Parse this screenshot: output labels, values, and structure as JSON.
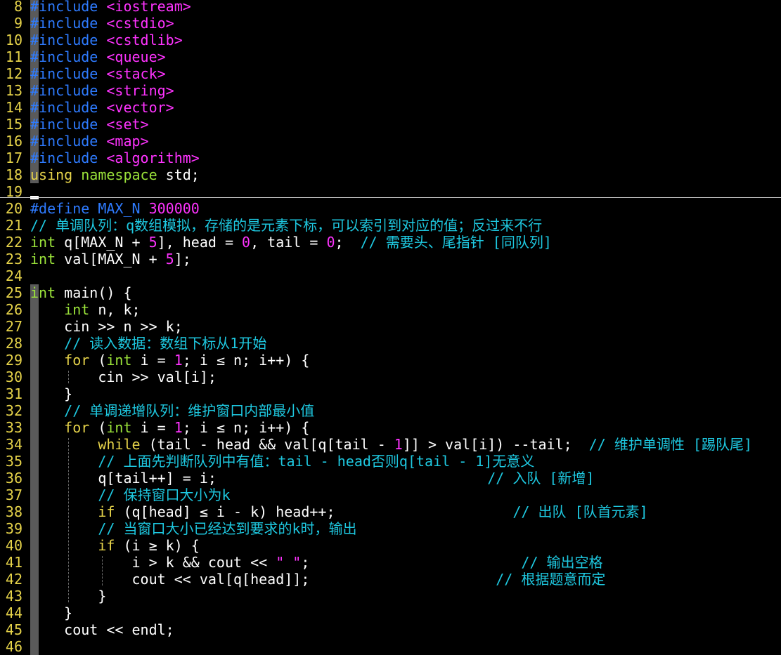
{
  "colors": {
    "linenumber": "#e6d34a",
    "default": "#ffffff",
    "preproc": "#2e7bff",
    "header": "#ff33ff",
    "type": "#9be33a",
    "keyword": "#e6d34a",
    "number": "#ff33ff",
    "comment": "#1ec8e0",
    "string": "#ff33ff"
  },
  "editor": {
    "lines": [
      {
        "n": "8",
        "tokens": [
          {
            "t": "#include",
            "c": "preproc"
          },
          {
            "t": " <iostream>",
            "c": "header"
          }
        ]
      },
      {
        "n": "9",
        "tokens": [
          {
            "t": "#include",
            "c": "preproc"
          },
          {
            "t": " <cstdio>",
            "c": "header"
          }
        ]
      },
      {
        "n": "10",
        "tokens": [
          {
            "t": "#include",
            "c": "preproc"
          },
          {
            "t": " <cstdlib>",
            "c": "header"
          }
        ]
      },
      {
        "n": "11",
        "tokens": [
          {
            "t": "#include",
            "c": "preproc"
          },
          {
            "t": " <queue>",
            "c": "header"
          }
        ]
      },
      {
        "n": "12",
        "tokens": [
          {
            "t": "#include",
            "c": "preproc"
          },
          {
            "t": " <stack>",
            "c": "header"
          }
        ]
      },
      {
        "n": "13",
        "tokens": [
          {
            "t": "#include",
            "c": "preproc"
          },
          {
            "t": " <string>",
            "c": "header"
          }
        ]
      },
      {
        "n": "14",
        "tokens": [
          {
            "t": "#include",
            "c": "preproc"
          },
          {
            "t": " <vector>",
            "c": "header"
          }
        ]
      },
      {
        "n": "15",
        "tokens": [
          {
            "t": "#include",
            "c": "preproc"
          },
          {
            "t": " <set>",
            "c": "header"
          }
        ]
      },
      {
        "n": "16",
        "tokens": [
          {
            "t": "#include",
            "c": "preproc"
          },
          {
            "t": " <map>",
            "c": "header"
          }
        ]
      },
      {
        "n": "17",
        "tokens": [
          {
            "t": "#include",
            "c": "preproc"
          },
          {
            "t": " <algorithm>",
            "c": "header"
          }
        ]
      },
      {
        "n": "18",
        "tokens": [
          {
            "t": "using",
            "c": "keyword"
          },
          {
            "t": " namespace",
            "c": "type"
          },
          {
            "t": " std;",
            "c": "default"
          }
        ]
      },
      {
        "n": "19",
        "tokens": []
      },
      {
        "n": "20",
        "tokens": [
          {
            "t": "#define MAX_N",
            "c": "preproc"
          },
          {
            "t": " 300000",
            "c": "number"
          }
        ]
      },
      {
        "n": "21",
        "tokens": [
          {
            "t": "// 单调队列：q数组模拟，存储的是元素下标，可以索引到对应的值；反过来不行",
            "c": "comment"
          }
        ]
      },
      {
        "n": "22",
        "tokens": [
          {
            "t": "int",
            "c": "type"
          },
          {
            "t": " q[MAX_N + ",
            "c": "default"
          },
          {
            "t": "5",
            "c": "number"
          },
          {
            "t": "], head = ",
            "c": "default"
          },
          {
            "t": "0",
            "c": "number"
          },
          {
            "t": ", tail = ",
            "c": "default"
          },
          {
            "t": "0",
            "c": "number"
          },
          {
            "t": ";  ",
            "c": "default"
          },
          {
            "t": "// 需要头、尾指针 [同队列]",
            "c": "comment"
          }
        ]
      },
      {
        "n": "23",
        "tokens": [
          {
            "t": "int",
            "c": "type"
          },
          {
            "t": " val[MAX_N + ",
            "c": "default"
          },
          {
            "t": "5",
            "c": "number"
          },
          {
            "t": "];",
            "c": "default"
          }
        ]
      },
      {
        "n": "24",
        "tokens": []
      },
      {
        "n": "25",
        "tokens": [
          {
            "t": "int",
            "c": "type"
          },
          {
            "t": " main() {",
            "c": "default"
          }
        ]
      },
      {
        "n": "26",
        "tokens": [
          {
            "t": "    ",
            "c": "default"
          },
          {
            "t": "int",
            "c": "type"
          },
          {
            "t": " n, k;",
            "c": "default"
          }
        ]
      },
      {
        "n": "27",
        "tokens": [
          {
            "t": "    cin >> n >> k;",
            "c": "default"
          }
        ]
      },
      {
        "n": "28",
        "tokens": [
          {
            "t": "    ",
            "c": "default"
          },
          {
            "t": "// 读入数据：数组下标从1开始",
            "c": "comment"
          }
        ]
      },
      {
        "n": "29",
        "tokens": [
          {
            "t": "    ",
            "c": "default"
          },
          {
            "t": "for",
            "c": "keyword"
          },
          {
            "t": " (",
            "c": "default"
          },
          {
            "t": "int",
            "c": "type"
          },
          {
            "t": " i = ",
            "c": "default"
          },
          {
            "t": "1",
            "c": "number"
          },
          {
            "t": "; i ≤ n; i++) {",
            "c": "default"
          }
        ]
      },
      {
        "n": "30",
        "tokens": [
          {
            "t": "        cin >> val[i];",
            "c": "default"
          }
        ]
      },
      {
        "n": "31",
        "tokens": [
          {
            "t": "    }",
            "c": "default"
          }
        ]
      },
      {
        "n": "32",
        "tokens": [
          {
            "t": "    ",
            "c": "default"
          },
          {
            "t": "// 单调递增队列：维护窗口内部最小值",
            "c": "comment"
          }
        ]
      },
      {
        "n": "33",
        "tokens": [
          {
            "t": "    ",
            "c": "default"
          },
          {
            "t": "for",
            "c": "keyword"
          },
          {
            "t": " (",
            "c": "default"
          },
          {
            "t": "int",
            "c": "type"
          },
          {
            "t": " i = ",
            "c": "default"
          },
          {
            "t": "1",
            "c": "number"
          },
          {
            "t": "; i ≤ n; i++) {",
            "c": "default"
          }
        ]
      },
      {
        "n": "34",
        "tokens": [
          {
            "t": "        ",
            "c": "default"
          },
          {
            "t": "while",
            "c": "keyword"
          },
          {
            "t": " (tail - head && val[q[tail - ",
            "c": "default"
          },
          {
            "t": "1",
            "c": "number"
          },
          {
            "t": "]] > val[i]) --tail;  ",
            "c": "default"
          },
          {
            "t": "// 维护单调性 [踢队尾]",
            "c": "comment"
          }
        ]
      },
      {
        "n": "35",
        "tokens": [
          {
            "t": "        ",
            "c": "default"
          },
          {
            "t": "// 上面先判断队列中有值：tail - head否则q[tail - 1]无意义",
            "c": "comment"
          }
        ]
      },
      {
        "n": "36",
        "tokens": [
          {
            "t": "        q[tail++] = i;                                ",
            "c": "default"
          },
          {
            "t": "// 入队 [新增]",
            "c": "comment"
          }
        ]
      },
      {
        "n": "37",
        "tokens": [
          {
            "t": "        ",
            "c": "default"
          },
          {
            "t": "// 保持窗口大小为k",
            "c": "comment"
          }
        ]
      },
      {
        "n": "38",
        "tokens": [
          {
            "t": "        ",
            "c": "default"
          },
          {
            "t": "if",
            "c": "keyword"
          },
          {
            "t": " (q[head] ≤ i - k) head++;                     ",
            "c": "default"
          },
          {
            "t": "// 出队 [队首元素]",
            "c": "comment"
          }
        ]
      },
      {
        "n": "39",
        "tokens": [
          {
            "t": "        ",
            "c": "default"
          },
          {
            "t": "// 当窗口大小已经达到要求的k时，输出",
            "c": "comment"
          }
        ]
      },
      {
        "n": "40",
        "tokens": [
          {
            "t": "        ",
            "c": "default"
          },
          {
            "t": "if",
            "c": "keyword"
          },
          {
            "t": " (i ≥ k) {",
            "c": "default"
          }
        ]
      },
      {
        "n": "41",
        "tokens": [
          {
            "t": "            i > k && cout << ",
            "c": "default"
          },
          {
            "t": "\" \"",
            "c": "string"
          },
          {
            "t": ";                         ",
            "c": "default"
          },
          {
            "t": "// 输出空格",
            "c": "comment"
          }
        ]
      },
      {
        "n": "42",
        "tokens": [
          {
            "t": "            cout << val[q[head]];                      ",
            "c": "default"
          },
          {
            "t": "// 根据题意而定",
            "c": "comment"
          }
        ]
      },
      {
        "n": "43",
        "tokens": [
          {
            "t": "        }",
            "c": "default"
          }
        ]
      },
      {
        "n": "44",
        "tokens": [
          {
            "t": "    }",
            "c": "default"
          }
        ]
      },
      {
        "n": "45",
        "tokens": [
          {
            "t": "    cout << endl;",
            "c": "default"
          }
        ]
      },
      {
        "n": "46",
        "tokens": []
      }
    ]
  }
}
